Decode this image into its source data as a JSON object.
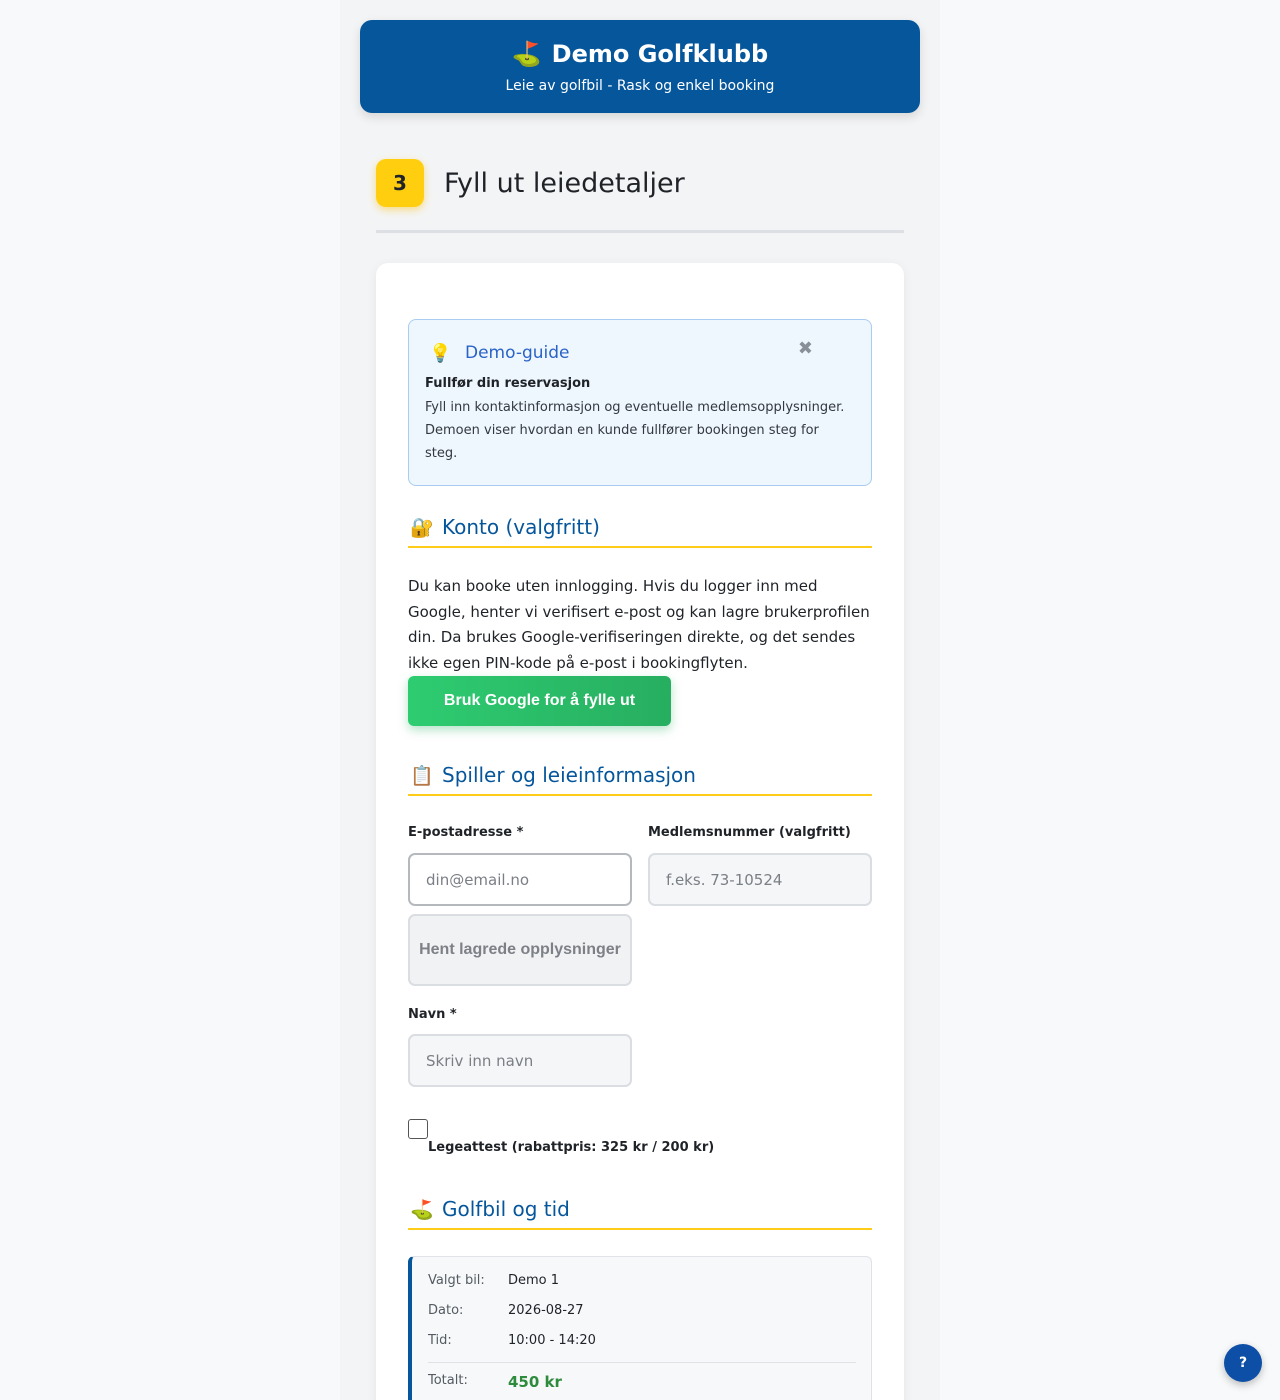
{
  "header": {
    "icon": "⛳",
    "title": "Demo Golfklubb",
    "subtitle": "Leie av golfbil - Rask og enkel booking"
  },
  "step": {
    "number": "3",
    "title": "Fyll ut leiedetaljer"
  },
  "guide": {
    "icon": "💡",
    "title": "Demo-guide",
    "close": "✖",
    "subtitle": "Fullfør din reservasjon",
    "body": "Fyll inn kontaktinformasjon og eventuelle medlemsopplysninger. Demoen viser hvordan en kunde fullfører bookingen steg for steg."
  },
  "konto": {
    "icon": "🔐",
    "title": "Konto (valgfritt)",
    "text": "Du kan booke uten innlogging. Hvis du logger inn med Google, henter vi verifisert e-post og kan lagre brukerprofilen din. Da brukes Google-verifiseringen direkte, og det sendes ikke egen PIN-kode på e-post i bookingflyten.",
    "google_button": "Bruk Google for å fylle ut"
  },
  "player": {
    "icon": "📋",
    "title": "Spiller og leieinformasjon",
    "email_label": "E-postadresse *",
    "email_placeholder": "din@email.no",
    "member_label": "Medlemsnummer (valgfritt)",
    "member_placeholder": "f.eks. 73-10524",
    "fetch_button": "Hent lagrede opplysninger",
    "name_label": "Navn *",
    "name_placeholder": "Skriv inn navn",
    "checkbox_label": "Legeattest (rabattpris: 325 kr / 200 kr)",
    "checkbox_checked": false
  },
  "cart": {
    "icon": "⛳",
    "title": "Golfbil og tid",
    "car_key": "Valgt bil:",
    "car_val": "Demo 1",
    "date_key": "Dato:",
    "date_val": "2026-08-27",
    "time_key": "Tid:",
    "time_val": "10:00 - 14:20",
    "total_key": "Totalt:",
    "total_val": "450 kr"
  },
  "help": {
    "label": "?"
  },
  "colors": {
    "primary": "#06569b",
    "accent": "#ffcf0f",
    "success": "#27ae60"
  }
}
